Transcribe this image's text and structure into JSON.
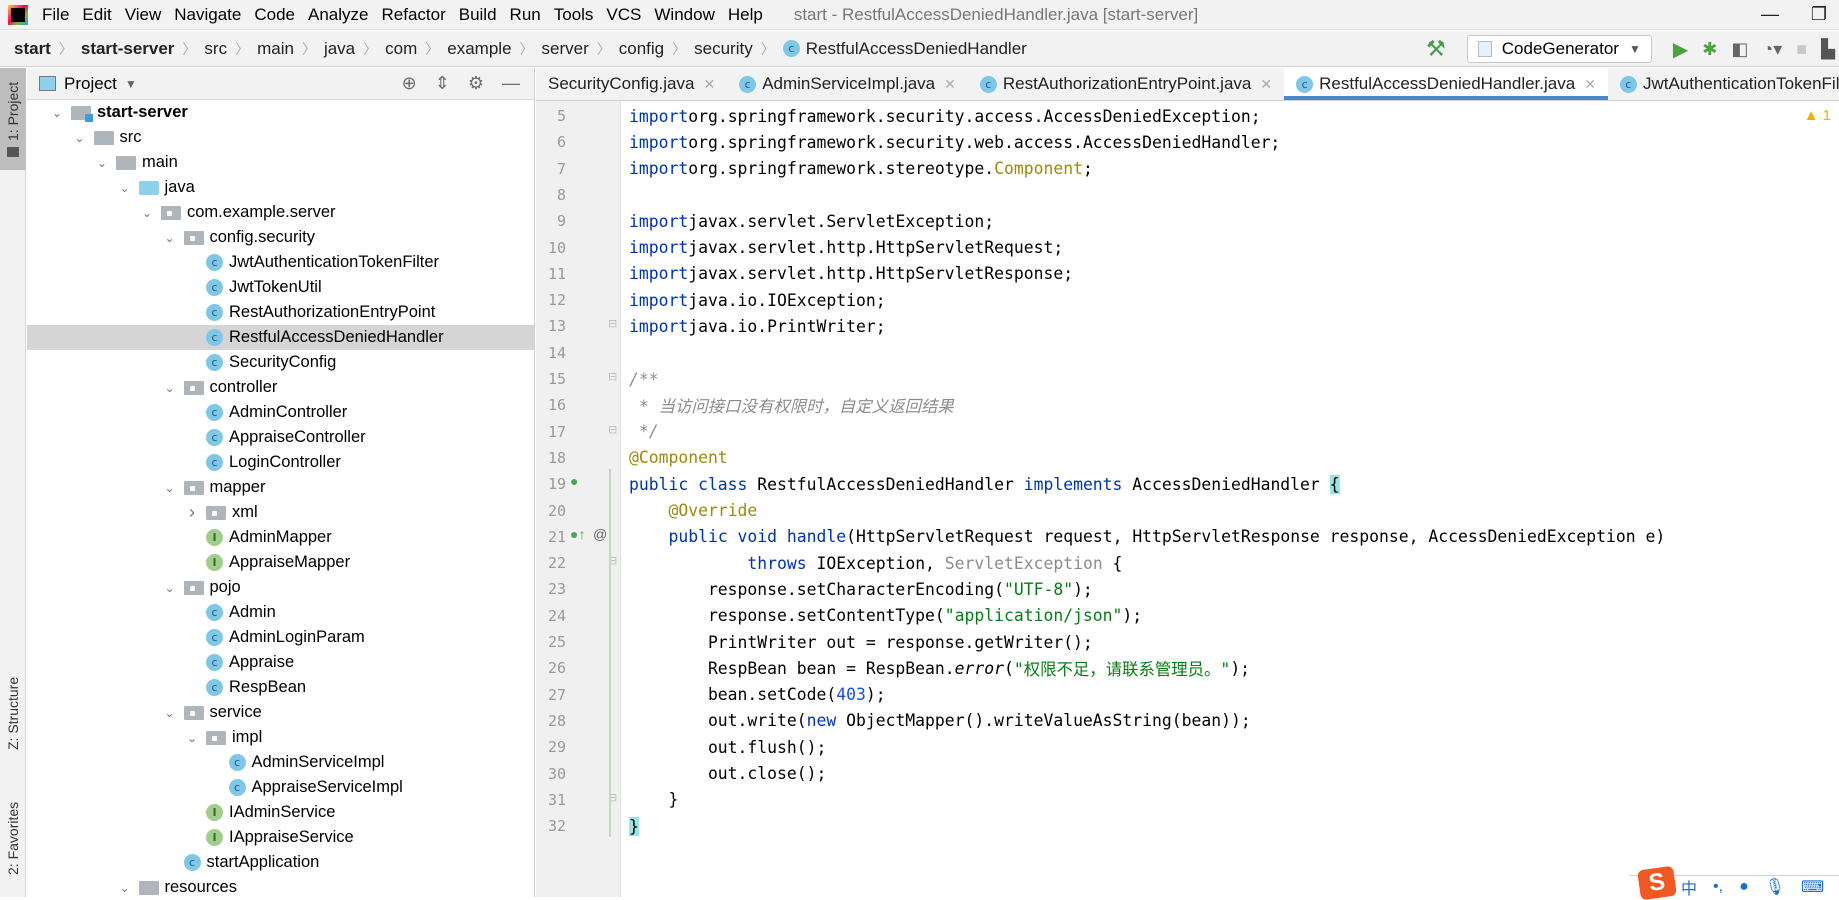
{
  "menubar": {
    "items": [
      "File",
      "Edit",
      "View",
      "Navigate",
      "Code",
      "Analyze",
      "Refactor",
      "Build",
      "Run",
      "Tools",
      "VCS",
      "Window",
      "Help"
    ],
    "window_title": "start - RestfulAccessDeniedHandler.java [start-server]"
  },
  "breadcrumb": {
    "items": [
      "start",
      "start-server",
      "src",
      "main",
      "java",
      "com",
      "example",
      "server",
      "config",
      "security",
      "RestfulAccessDeniedHandler"
    ]
  },
  "toolbar": {
    "run_config": "CodeGenerator"
  },
  "side_tabs": {
    "project": "1: Project",
    "structure": "Z: Structure",
    "favorites": "2: Favorites"
  },
  "project_panel": {
    "title": "Project",
    "tree": [
      {
        "label": "start-server",
        "depth": 0,
        "type": "module",
        "expanded": true,
        "bold": true
      },
      {
        "label": "src",
        "depth": 1,
        "type": "folder",
        "expanded": true
      },
      {
        "label": "main",
        "depth": 2,
        "type": "folder",
        "expanded": true
      },
      {
        "label": "java",
        "depth": 3,
        "type": "source",
        "expanded": true
      },
      {
        "label": "com.example.server",
        "depth": 4,
        "type": "package",
        "expanded": true
      },
      {
        "label": "config.security",
        "depth": 5,
        "type": "package",
        "expanded": true
      },
      {
        "label": "JwtAuthenticationTokenFilter",
        "depth": 6,
        "type": "class"
      },
      {
        "label": "JwtTokenUtil",
        "depth": 6,
        "type": "class"
      },
      {
        "label": "RestAuthorizationEntryPoint",
        "depth": 6,
        "type": "class"
      },
      {
        "label": "RestfulAccessDeniedHandler",
        "depth": 6,
        "type": "class",
        "selected": true
      },
      {
        "label": "SecurityConfig",
        "depth": 6,
        "type": "class"
      },
      {
        "label": "controller",
        "depth": 5,
        "type": "package",
        "expanded": true
      },
      {
        "label": "AdminController",
        "depth": 6,
        "type": "class"
      },
      {
        "label": "AppraiseController",
        "depth": 6,
        "type": "class"
      },
      {
        "label": "LoginController",
        "depth": 6,
        "type": "class"
      },
      {
        "label": "mapper",
        "depth": 5,
        "type": "package",
        "expanded": true
      },
      {
        "label": "xml",
        "depth": 6,
        "type": "package",
        "expanded": false
      },
      {
        "label": "AdminMapper",
        "depth": 6,
        "type": "interface"
      },
      {
        "label": "AppraiseMapper",
        "depth": 6,
        "type": "interface"
      },
      {
        "label": "pojo",
        "depth": 5,
        "type": "package",
        "expanded": true
      },
      {
        "label": "Admin",
        "depth": 6,
        "type": "class"
      },
      {
        "label": "AdminLoginParam",
        "depth": 6,
        "type": "class"
      },
      {
        "label": "Appraise",
        "depth": 6,
        "type": "class"
      },
      {
        "label": "RespBean",
        "depth": 6,
        "type": "class"
      },
      {
        "label": "service",
        "depth": 5,
        "type": "package",
        "expanded": true
      },
      {
        "label": "impl",
        "depth": 6,
        "type": "package",
        "expanded": true
      },
      {
        "label": "AdminServiceImpl",
        "depth": 7,
        "type": "class"
      },
      {
        "label": "AppraiseServiceImpl",
        "depth": 7,
        "type": "class"
      },
      {
        "label": "IAdminService",
        "depth": 6,
        "type": "interface"
      },
      {
        "label": "IAppraiseService",
        "depth": 6,
        "type": "interface"
      },
      {
        "label": "startApplication",
        "depth": 5,
        "type": "class"
      },
      {
        "label": "resources",
        "depth": 3,
        "type": "folder",
        "expanded": true
      }
    ]
  },
  "editor_tabs": [
    {
      "label": "SecurityConfig.java",
      "active": false
    },
    {
      "label": "AdminServiceImpl.java",
      "active": false
    },
    {
      "label": "RestAuthorizationEntryPoint.java",
      "active": false
    },
    {
      "label": "RestfulAccessDeniedHandler.java",
      "active": true
    },
    {
      "label": "JwtAuthenticationTokenFilter.java",
      "active": false
    }
  ],
  "editor": {
    "warning_count": "1",
    "lines": [
      {
        "n": "5",
        "tokens": [
          [
            "kw",
            "import"
          ],
          [
            "",
            "org.springframework.security.access.AccessDeniedException;"
          ]
        ]
      },
      {
        "n": "6",
        "tokens": [
          [
            "kw",
            "import"
          ],
          [
            "",
            "org.springframework.security.web.access.AccessDeniedHandler;"
          ]
        ]
      },
      {
        "n": "7",
        "tokens": [
          [
            "kw",
            "import"
          ],
          [
            "",
            "org.springframework.stereotype."
          ],
          [
            "ann",
            "Component"
          ],
          [
            "",
            ";"
          ]
        ]
      },
      {
        "n": "8",
        "tokens": []
      },
      {
        "n": "9",
        "tokens": [
          [
            "kw",
            "import"
          ],
          [
            "",
            "javax.servlet.ServletException;"
          ]
        ]
      },
      {
        "n": "10",
        "tokens": [
          [
            "kw",
            "import"
          ],
          [
            "",
            "javax.servlet.http.HttpServletRequest;"
          ]
        ]
      },
      {
        "n": "11",
        "tokens": [
          [
            "kw",
            "import"
          ],
          [
            "",
            "javax.servlet.http.HttpServletResponse;"
          ]
        ]
      },
      {
        "n": "12",
        "tokens": [
          [
            "kw",
            "import"
          ],
          [
            "",
            "java.io.IOException;"
          ]
        ]
      },
      {
        "n": "13",
        "tokens": [
          [
            "kw",
            "import"
          ],
          [
            "",
            "java.io.PrintWriter;"
          ]
        ]
      },
      {
        "n": "14",
        "tokens": []
      },
      {
        "n": "15",
        "tokens": [
          [
            "com",
            "/**"
          ]
        ]
      },
      {
        "n": "16",
        "tokens": [
          [
            "com",
            " * 当访问接口没有权限时，自定义返回结果"
          ]
        ]
      },
      {
        "n": "17",
        "tokens": [
          [
            "com",
            " */"
          ]
        ]
      },
      {
        "n": "18",
        "tokens": [
          [
            "ann",
            "@Component"
          ]
        ]
      },
      {
        "n": "19",
        "tokens": [
          [
            "kw",
            "public class"
          ],
          [
            "",
            " RestfulAccessDeniedHandler "
          ],
          [
            "kw",
            "implements"
          ],
          [
            "",
            " AccessDeniedHandler "
          ],
          [
            "brace-hl",
            "{"
          ]
        ]
      },
      {
        "n": "20",
        "tokens": [
          [
            "",
            "    "
          ],
          [
            "ann",
            "@Override"
          ]
        ]
      },
      {
        "n": "21",
        "tokens": [
          [
            "",
            "    "
          ],
          [
            "kw",
            "public void"
          ],
          [
            "",
            " "
          ],
          [
            "kw",
            "handle"
          ],
          [
            "",
            "(HttpServletRequest request, HttpServletResponse response, AccessDeniedException e)"
          ]
        ]
      },
      {
        "n": "22",
        "tokens": [
          [
            "",
            "            "
          ],
          [
            "kw",
            "throws"
          ],
          [
            "",
            " IOException, "
          ],
          [
            "gray",
            "ServletException"
          ],
          [
            "",
            " {"
          ]
        ]
      },
      {
        "n": "23",
        "tokens": [
          [
            "",
            "        response.setCharacterEncoding("
          ],
          [
            "str",
            "\"UTF-8\""
          ],
          [
            "",
            ");"
          ]
        ]
      },
      {
        "n": "24",
        "tokens": [
          [
            "",
            "        response.setContentType("
          ],
          [
            "str",
            "\"application/json\""
          ],
          [
            "",
            ");"
          ]
        ]
      },
      {
        "n": "25",
        "tokens": [
          [
            "",
            "        PrintWriter out = response.getWriter();"
          ]
        ]
      },
      {
        "n": "26",
        "tokens": [
          [
            "",
            "        RespBean bean = RespBean."
          ],
          [
            "ital",
            "error"
          ],
          [
            "",
            "("
          ],
          [
            "str",
            "\"权限不足，请联系管理员。\""
          ],
          [
            "",
            ");"
          ]
        ]
      },
      {
        "n": "27",
        "tokens": [
          [
            "",
            "        bean.setCode("
          ],
          [
            "num",
            "403"
          ],
          [
            "",
            ");"
          ]
        ]
      },
      {
        "n": "28",
        "tokens": [
          [
            "",
            "        out.write("
          ],
          [
            "kw",
            "new"
          ],
          [
            "",
            " ObjectMapper().writeValueAsString(bean));"
          ]
        ]
      },
      {
        "n": "29",
        "tokens": [
          [
            "",
            "        out.flush();"
          ]
        ]
      },
      {
        "n": "30",
        "tokens": [
          [
            "",
            "        out.close();"
          ]
        ]
      },
      {
        "n": "31",
        "tokens": [
          [
            "",
            "    }"
          ]
        ]
      },
      {
        "n": "32",
        "tokens": [
          [
            "brace-hl",
            "}"
          ]
        ]
      }
    ]
  },
  "ime_bar": {
    "logo": "S",
    "mode": "中"
  }
}
